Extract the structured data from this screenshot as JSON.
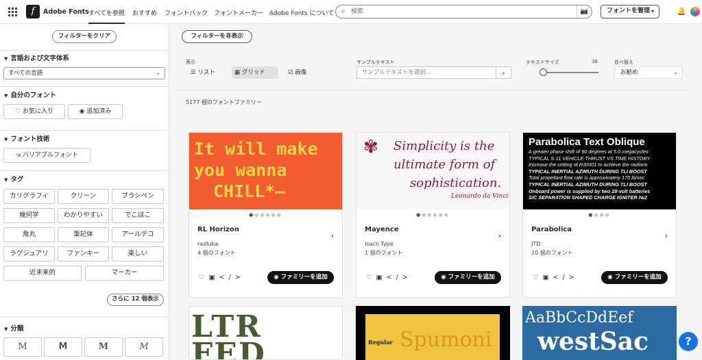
{
  "topbar": {
    "brand": "Adobe Fonts",
    "nav": [
      "すべてを参照",
      "おすすめ",
      "フォントパック",
      "フォントメーカー",
      "Adobe Fonts について"
    ],
    "search_placeholder": "検索",
    "manage_label": "フォントを管理"
  },
  "sidebar": {
    "clear_label": "フィルターをクリア",
    "lang_title": "言語および文字体系",
    "lang_value": "すべての言語",
    "myfonts_title": "自分のフォント",
    "favorites_label": "お気に入り",
    "added_label": "追加済み",
    "tech_title": "フォント技術",
    "variable_label": "バリアブルフォント",
    "tags_title": "タグ",
    "tags": [
      "カリグラフィ",
      "クリーン",
      "ブラシペン",
      "幾何学",
      "わかりやすい",
      "でこぼこ",
      "角丸",
      "筆記体",
      "アールデコ",
      "ラグジュアリ",
      "ファンキー",
      "楽しい",
      "近未来的",
      "マーカー"
    ],
    "more_tags_label": "さらに 12 個表示",
    "classification_title": "分類",
    "classification_glyph": "M"
  },
  "toolbar": {
    "hide_filters_label": "フィルターを非表示",
    "display_label": "表示",
    "list_label": "リスト",
    "grid_label": "グリッド",
    "image_label": "画像",
    "image_checked": true,
    "sample_label": "サンプルテキスト",
    "sample_placeholder": "サンプルテキストを選択...",
    "textsize_label": "テキストサイズ",
    "textsize_value": "36",
    "sort_label": "並べ替え",
    "sort_value": "お勧め"
  },
  "results_count": "5177 個のフォントファミリー",
  "cards": [
    {
      "name": "RL Horizon",
      "foundry": "radluka",
      "count": "4 個のフォント",
      "preview_lines": [
        "It will make",
        "you wanna",
        "CHILL*—"
      ],
      "bg": "#f25c2e",
      "fg": "#f5d94a"
    },
    {
      "name": "Mayence",
      "foundry": "Isaco Type",
      "count": "1 個のフォント",
      "preview_lines": [
        "Simplicity is the",
        "ultimate form of",
        "sophistication.",
        "Leonardo da Vinci"
      ],
      "bg": "#f8f6f6",
      "fg": "#8a1d3c"
    },
    {
      "name": "Parabolica",
      "foundry": "JTD",
      "count": "20 個のフォント",
      "preview_lines": [
        "Parabolica Text Oblique",
        "A greater phase shift of 90 degrees at 5.0 megacycles",
        "TYPICAL S-11 VEHICLE THRUST VS TIME HISTORY",
        "Increase the setting of R30001 to achieve the ravform",
        "TYPICAL INERTIAL AZIMUTH DURING TLI BOOST",
        "Total propellant flow rate is approximately 170 lb/sec",
        "TYPICAL INERTIAL AZIMUTH DURING TLI BOOST",
        "Onboard power is supplied by two 28-volt batteries",
        "S/C SEPARATION SHAPED CHARGE IGNITER №2"
      ],
      "bg": "#000000",
      "fg": "#ffffff"
    }
  ],
  "add_family_label": "ファミリーを追加",
  "bottom_previews": [
    {
      "lines": [
        "LTR",
        "FED"
      ]
    },
    {
      "lines": [
        "Regular",
        "Spumoni L"
      ]
    },
    {
      "lines": [
        "AaBbCcDdEef",
        "westSac"
      ]
    }
  ],
  "help_label": "?"
}
